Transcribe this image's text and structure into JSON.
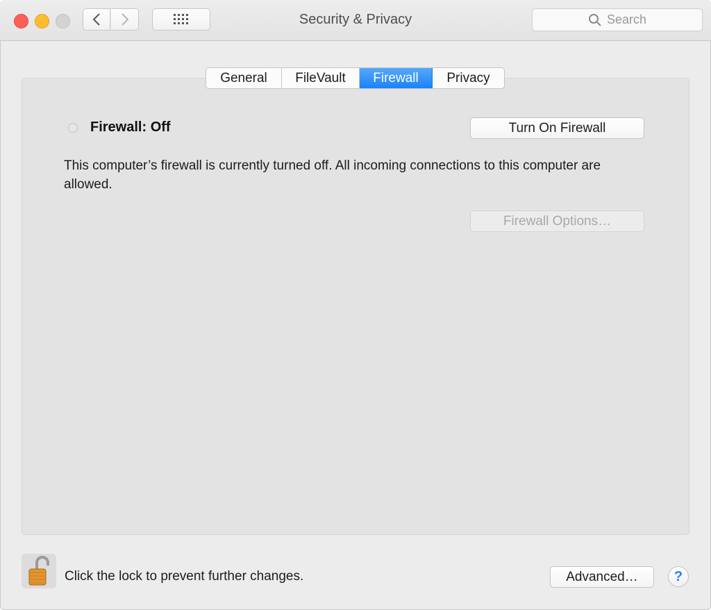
{
  "window": {
    "title": "Security & Privacy"
  },
  "toolbar": {
    "search_placeholder": "Search",
    "back_icon": "chevron-left-icon",
    "forward_icon": "chevron-right-icon",
    "grid_icon": "grid-icon"
  },
  "tabs": [
    {
      "label": "General",
      "selected": false
    },
    {
      "label": "FileVault",
      "selected": false
    },
    {
      "label": "Firewall",
      "selected": true
    },
    {
      "label": "Privacy",
      "selected": false
    }
  ],
  "firewall": {
    "status_label": "Firewall: Off",
    "turn_on_label": "Turn On Firewall",
    "description": "This computer’s firewall is currently turned off. All incoming connections to this computer are allowed.",
    "options_label": "Firewall Options…",
    "options_enabled": false
  },
  "footer": {
    "lock_text": "Click the lock to prevent further changes.",
    "lock_icon": "unlocked-padlock-icon",
    "advanced_label": "Advanced…",
    "help_label": "?"
  },
  "colors": {
    "accent": "#1a82fa",
    "close": "#fc5f57",
    "minimize": "#fdbc2e",
    "zoom_disabled": "#d3d3d3"
  }
}
